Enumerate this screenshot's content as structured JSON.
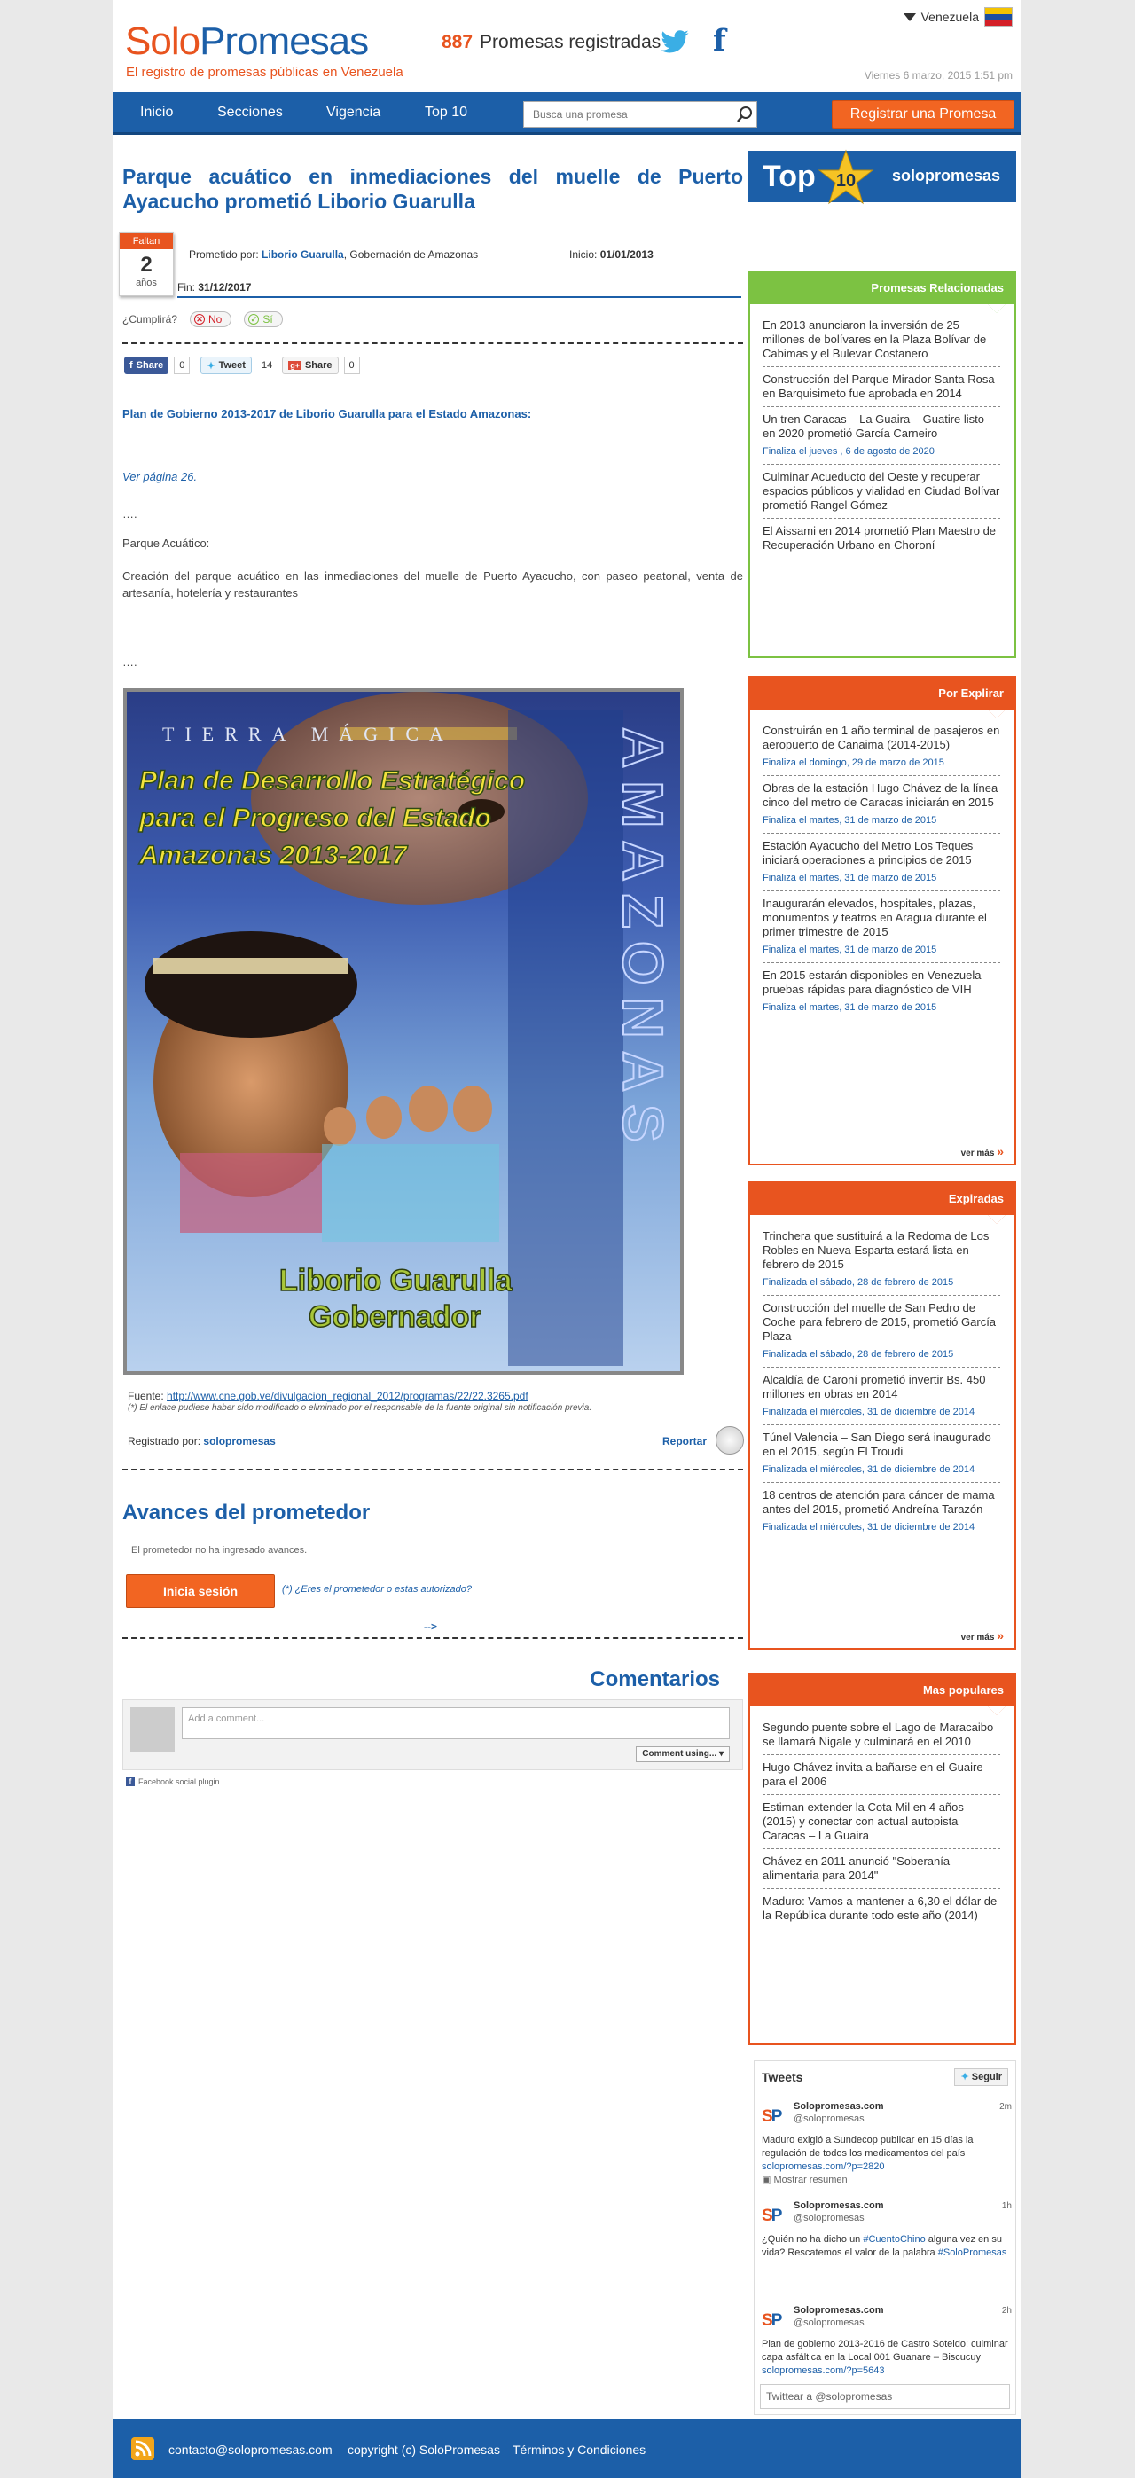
{
  "header": {
    "logo_solo": "Solo",
    "logo_promesas": "Promesas",
    "tagline": "El registro de promesas públicas en Venezuela",
    "promise_count": "887",
    "promise_count_label": "Promesas registradas",
    "country": "Venezuela",
    "date": "Viernes 6 marzo, 2015 1:51 pm",
    "flag_colors": [
      "#f4c300",
      "#1c4fa0",
      "#d41f27"
    ]
  },
  "nav": {
    "items": [
      "Inicio",
      "Secciones",
      "Vigencia",
      "Top 10"
    ],
    "search_placeholder": "Busca una promesa",
    "register_button": "Registrar una Promesa"
  },
  "promise": {
    "title": "Parque acuático en inmediaciones del muelle de Puerto Ayacucho prometió Liborio Guarulla",
    "faltan_label": "Faltan",
    "faltan_number": "2",
    "faltan_unit": "años",
    "promised_by_label": "Prometido por:",
    "promised_by_name": "Liborio Guarulla",
    "promised_by_org": ", Gobernación de Amazonas",
    "inicio_label": "Inicio:",
    "inicio_date": "01/01/2013",
    "fin_label": "Fin:",
    "fin_date": "31/12/2017",
    "cumplira_label": "¿Cumplirá?",
    "no_label": "No",
    "si_label": "Sí"
  },
  "share": {
    "fb_label": "Share",
    "fb_count": "0",
    "tweet_label": "Tweet",
    "tweet_count": "14",
    "gplus_label": "Share",
    "gplus_count": "0"
  },
  "article": {
    "heading": "Plan de Gobierno 2013-2017 de Liborio Guarulla para el Estado Amazonas:",
    "page_ref": "Ver página 26.",
    "ellipsis1": "….",
    "subhead": "Parque Acuático:",
    "body": "Creación del parque acuático en las inmediaciones del muelle de Puerto Ayacucho, con paseo peatonal, venta de artesanía, hotelería y restaurantes",
    "ellipsis2": "….",
    "poster_top": "TIERRA MÁGICA",
    "poster_title": [
      "Plan de Desarrollo Estratégico",
      "para el Progreso del Estado",
      "Amazonas 2013-2017"
    ],
    "poster_bottom": [
      "Liborio Guarulla",
      "Gobernador"
    ],
    "poster_side": "AMAZONAS",
    "source_label": "Fuente:",
    "source_url": "http://www.cne.gob.ve/divulgacion_regional_2012/programas/22/22.3265.pdf",
    "source_note": "(*) El enlace pudiese haber sido modificado o eliminado por el responsable de la fuente original sin notificación previa.",
    "registered_by_label": "Registrado por:",
    "registered_by": "solopromesas",
    "report": "Reportar"
  },
  "avances": {
    "title": "Avances del prometedor",
    "empty": "El prometedor no ha ingresado avances.",
    "login": "Inicia sesión",
    "question": "(*) ¿Eres el prometedor o estas autorizado?",
    "arrow": "-->"
  },
  "comments": {
    "title": "Comentarios",
    "placeholder": "Add a comment...",
    "comment_using": "Comment using...",
    "plugin": "Facebook social plugin"
  },
  "sidebar": {
    "top10_label": "Top",
    "top10_num": "10",
    "top10_brand": "solopromesas",
    "relacionadas": {
      "title": "Promesas Relacionadas",
      "color": "#7cc242",
      "items": [
        {
          "text": "En 2013 anunciaron la inversión de 25 millones de bolívares en la Plaza Bolívar de Cabimas y el Bulevar Costanero",
          "date": ""
        },
        {
          "text": "Construcción del Parque Mirador Santa Rosa en Barquisimeto fue aprobada en 2014",
          "date": ""
        },
        {
          "text": "Un tren Caracas – La Guaira – Guatire listo en 2020 prometió García Carneiro",
          "date": "Finaliza el jueves , 6 de agosto de 2020"
        },
        {
          "text": "Culminar Acueducto del Oeste y recuperar espacios públicos y vialidad en Ciudad Bolívar prometió Rangel Gómez",
          "date": ""
        },
        {
          "text": "El Aissami en 2014 prometió Plan Maestro de Recuperación Urbano en Choroní",
          "date": ""
        }
      ]
    },
    "explorar": {
      "title": "Por Explirar",
      "color": "#e8541f",
      "items": [
        {
          "text": "Construirán en 1 año terminal de pasajeros en aeropuerto de Canaima (2014-2015)",
          "date": "Finaliza el domingo, 29 de marzo de 2015"
        },
        {
          "text": "Obras de la estación Hugo Chávez de la línea cinco del metro de Caracas iniciarán en 2015",
          "date": "Finaliza el martes, 31 de marzo de 2015"
        },
        {
          "text": "Estación Ayacucho del Metro Los Teques iniciará operaciones a principios de 2015",
          "date": "Finaliza el martes, 31 de marzo de 2015"
        },
        {
          "text": "Inaugurarán elevados, hospitales, plazas, monumentos y teatros en Aragua durante el primer trimestre de 2015",
          "date": "Finaliza el martes, 31 de marzo de 2015"
        },
        {
          "text": "En 2015 estarán disponibles en Venezuela pruebas rápidas para diagnóstico de VIH",
          "date": "Finaliza el martes, 31 de marzo de 2015"
        }
      ],
      "more": "ver más"
    },
    "expiradas": {
      "title": "Expiradas",
      "color": "#e8541f",
      "items": [
        {
          "text": "Trinchera que sustituirá a la Redoma de Los Robles en Nueva Esparta estará lista en febrero de 2015",
          "date": "Finalizada el sábado, 28 de febrero de 2015"
        },
        {
          "text": "Construcción del muelle de San Pedro de Coche para febrero de 2015, prometió García Plaza",
          "date": "Finalizada el sábado, 28 de febrero de 2015"
        },
        {
          "text": "Alcaldía de Caroní prometió invertir Bs. 450 millones en obras en 2014",
          "date": "Finalizada el miércoles, 31 de diciembre de 2014"
        },
        {
          "text": "Túnel Valencia – San Diego será inaugurado en el 2015, según El Troudi",
          "date": "Finalizada el miércoles, 31 de diciembre de 2014"
        },
        {
          "text": "18 centros de atención para cáncer de mama antes del 2015, prometió Andreína Tarazón",
          "date": "Finalizada el miércoles, 31 de diciembre de 2014"
        }
      ],
      "more": "ver más"
    },
    "populares": {
      "title": "Mas populares",
      "color": "#e8541f",
      "items": [
        {
          "text": "Segundo puente sobre el Lago de Maracaibo se llamará Nigale y culminará en el 2010",
          "date": ""
        },
        {
          "text": "Hugo Chávez invita a bañarse en el Guaire para el 2006",
          "date": ""
        },
        {
          "text": "Estiman extender la Cota Mil en 4 años (2015) y conectar con actual autopista Caracas – La Guaira",
          "date": ""
        },
        {
          "text": "Chávez en 2011 anunció \"Soberanía alimentaria para 2014\"",
          "date": ""
        },
        {
          "text": "Maduro: Vamos a mantener a 6,30 el dólar de la República durante todo este año (2014)",
          "date": ""
        }
      ]
    }
  },
  "tweets": {
    "title": "Tweets",
    "follow": "Seguir",
    "items": [
      {
        "name": "Solopromesas.com",
        "handle": "@solopromesas",
        "time": "2m",
        "pre": "Maduro exigió a Sundecop publicar en 15 días la regulación de todos los medicamentos del país ",
        "link": "solopromesas.com/?p=2820",
        "extra": "Mostrar resumen"
      },
      {
        "name": "Solopromesas.com",
        "handle": "@solopromesas",
        "time": "1h",
        "pre": "¿Quién no ha dicho un ",
        "link": "#CuentoChino",
        "post": " alguna vez en su vida? Rescatemos el valor de la palabra ",
        "link2": "#SoloPromesas"
      },
      {
        "name": "Solopromesas.com",
        "handle": "@solopromesas",
        "time": "2h",
        "pre": "Plan de gobierno 2013-2016 de Castro Soteldo: culminar capa asfáltica en la Local 001 Guanare – Biscucuy ",
        "link": "solopromesas.com/?p=5643"
      }
    ],
    "input_placeholder": "Twittear a @solopromesas"
  },
  "footer": {
    "email": "contacto@solopromesas.com",
    "copyright": "copyright (c) SoloPromesas",
    "terms": "Términos y Condiciones"
  }
}
